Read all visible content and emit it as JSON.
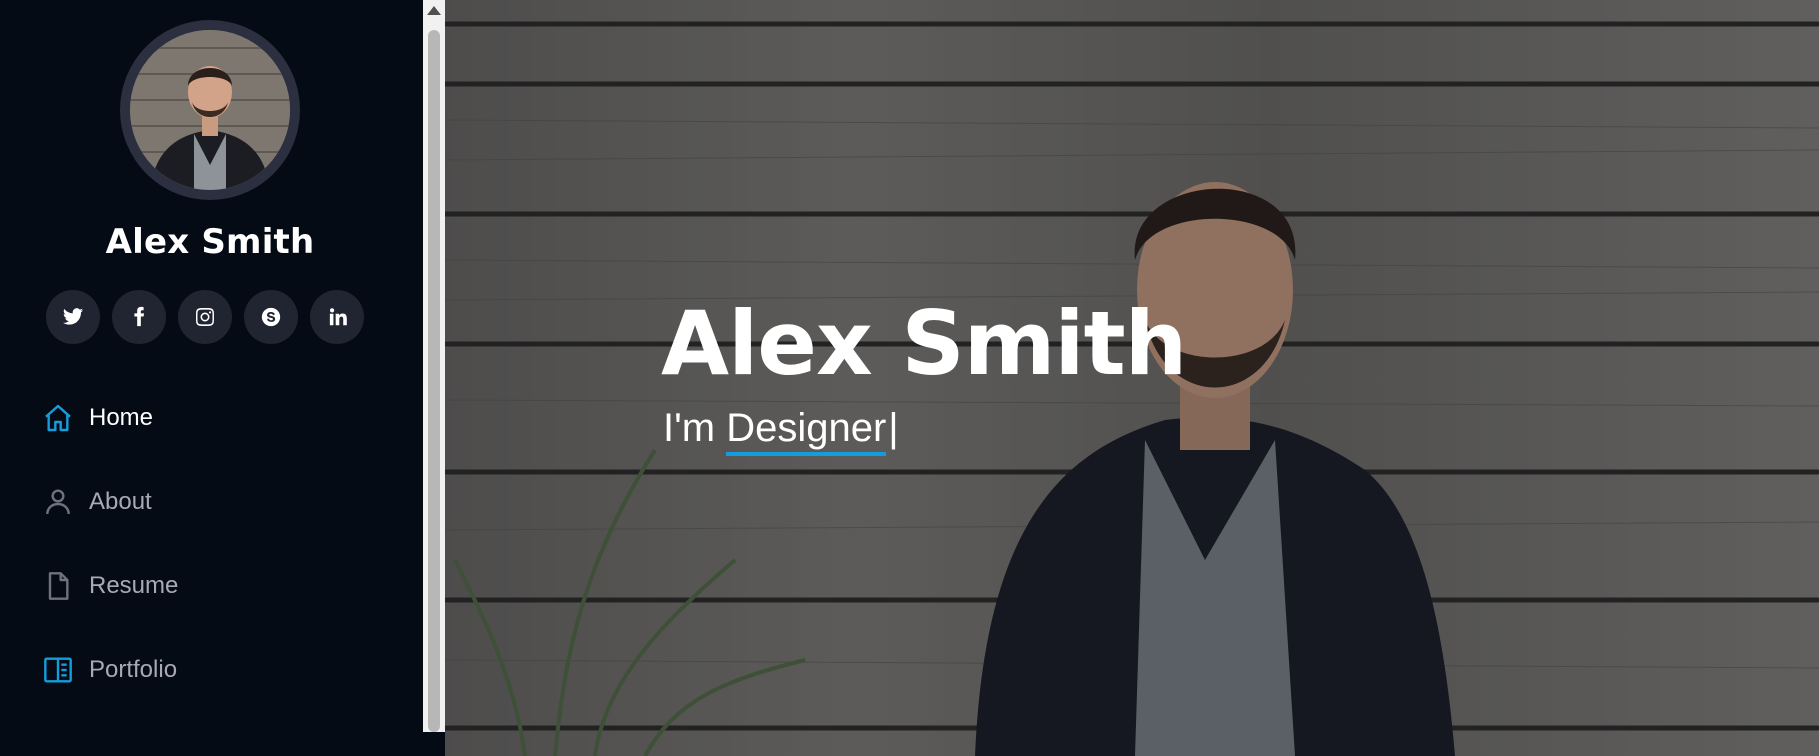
{
  "profile": {
    "name": "Alex Smith"
  },
  "social": [
    {
      "icon": "twitter-icon"
    },
    {
      "icon": "facebook-icon"
    },
    {
      "icon": "instagram-icon"
    },
    {
      "icon": "skype-icon"
    },
    {
      "icon": "linkedin-icon"
    }
  ],
  "nav": {
    "items": [
      {
        "label": "Home",
        "icon": "home-icon",
        "active": true
      },
      {
        "label": "About",
        "icon": "person-icon",
        "active": false
      },
      {
        "label": "Resume",
        "icon": "file-icon",
        "active": false
      },
      {
        "label": "Portfolio",
        "icon": "book-half-icon",
        "active": false
      }
    ]
  },
  "hero": {
    "title": "Alex Smith",
    "prefix": "I'm ",
    "typed": "Designer",
    "cursor": "|"
  },
  "colors": {
    "accent": "#149ddd",
    "sidebar_bg": "#040b14",
    "social_bg": "#212431",
    "avatar_ring": "#2c2f3f"
  }
}
